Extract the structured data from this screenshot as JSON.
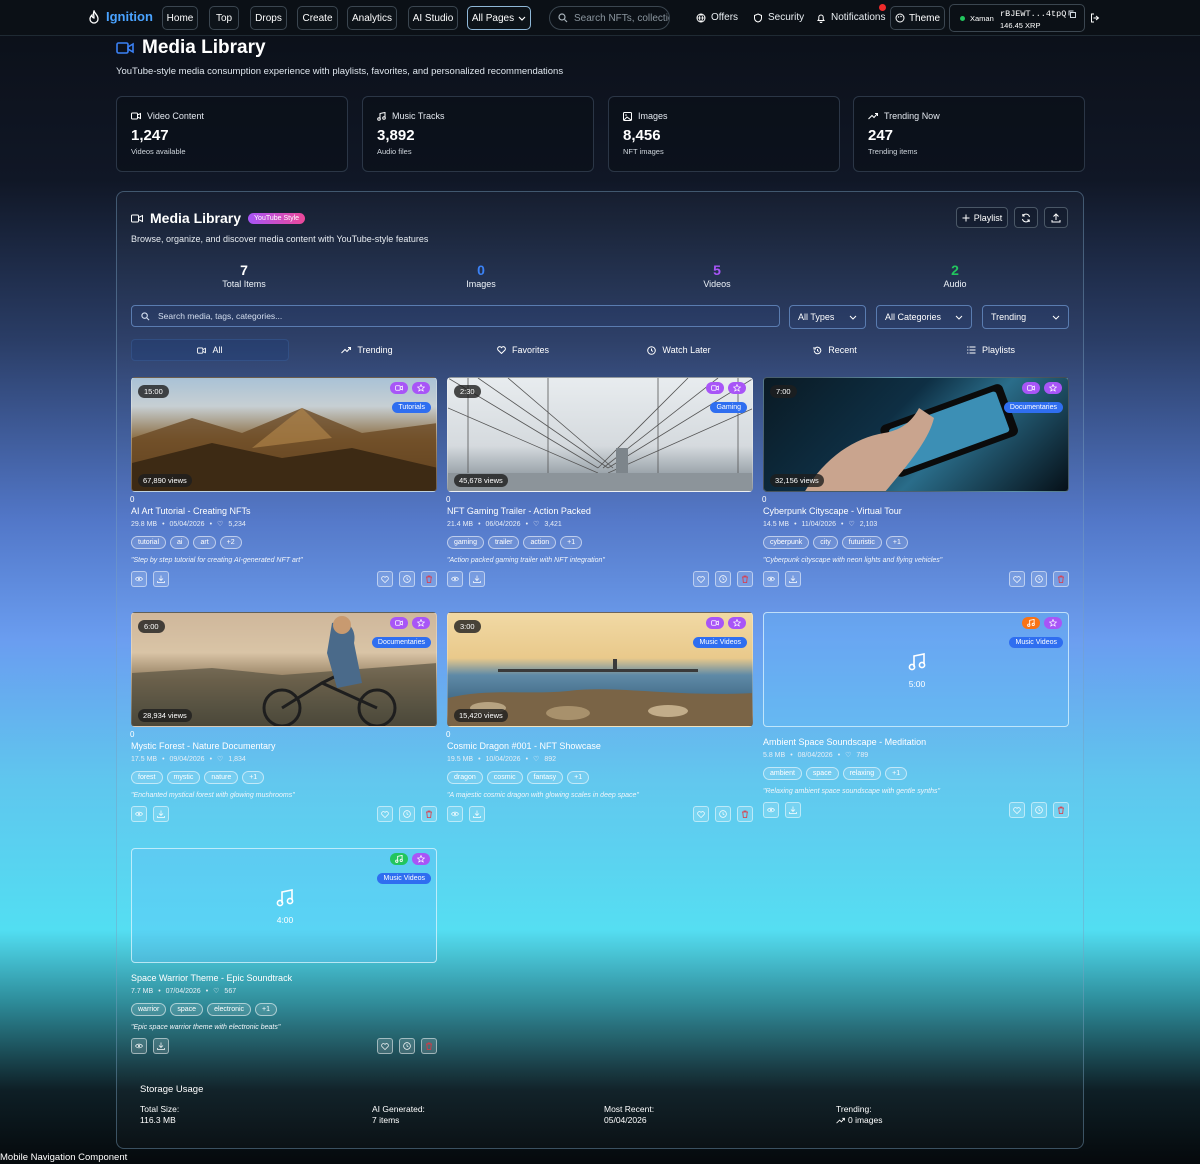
{
  "nav": {
    "brand": "Ignition",
    "items": [
      "Home",
      "Top",
      "Drops",
      "Create",
      "Analytics",
      "AI Studio"
    ],
    "all_pages": "All Pages",
    "search_placeholder": "Search NFTs, collections...",
    "offers": "Offers",
    "security": "Security",
    "notifications": "Notifications",
    "theme": "Theme",
    "wallet_name": "Xaman",
    "wallet_addr": "rBJEWT...4tpQ",
    "wallet_balance": "146.45 XRP"
  },
  "header": {
    "title": "Media Library",
    "subtitle": "YouTube-style media consumption experience with playlists, favorites, and personalized recommendations"
  },
  "stats": [
    {
      "label": "Video Content",
      "value": "1,247",
      "sub": "Videos available"
    },
    {
      "label": "Music Tracks",
      "value": "3,892",
      "sub": "Audio files"
    },
    {
      "label": "Images",
      "value": "8,456",
      "sub": "NFT images"
    },
    {
      "label": "Trending Now",
      "value": "247",
      "sub": "Trending items"
    }
  ],
  "library": {
    "title": "Media Library",
    "badge": "YouTube Style",
    "subtitle": "Browse, organize, and discover media content with YouTube-style features",
    "playlist_btn": "Playlist",
    "counts": [
      {
        "n": "7",
        "l": "Total Items",
        "color": "#ffffff"
      },
      {
        "n": "0",
        "l": "Images",
        "color": "#3b82f6"
      },
      {
        "n": "5",
        "l": "Videos",
        "color": "#a855f7"
      },
      {
        "n": "2",
        "l": "Audio",
        "color": "#22c55e"
      }
    ],
    "search_placeholder": "Search media, tags, categories...",
    "filters": [
      "All Types",
      "All Categories",
      "Trending"
    ],
    "tabs": [
      "All",
      "Trending",
      "Favorites",
      "Watch Later",
      "Recent",
      "Playlists"
    ]
  },
  "cards": [
    {
      "duration": "15:00",
      "views": "67,890 views",
      "category": "Tutorials",
      "zero": "0",
      "title": "AI Art Tutorial - Creating NFTs",
      "size": "29.8 MB",
      "date": "05/04/2026",
      "likes": "5,234",
      "tags": [
        "tutorial",
        "ai",
        "art",
        "+2"
      ],
      "desc": "\"Step by step tutorial for creating AI-generated NFT art\""
    },
    {
      "duration": "2:30",
      "views": "45,678 views",
      "category": "Gaming",
      "zero": "0",
      "title": "NFT Gaming Trailer - Action Packed",
      "size": "21.4 MB",
      "date": "06/04/2026",
      "likes": "3,421",
      "tags": [
        "gaming",
        "trailer",
        "action",
        "+1"
      ],
      "desc": "\"Action packed gaming trailer with NFT integration\""
    },
    {
      "duration": "7:00",
      "views": "32,156 views",
      "category": "Documentaries",
      "zero": "0",
      "title": "Cyberpunk Cityscape - Virtual Tour",
      "size": "14.5 MB",
      "date": "11/04/2026",
      "likes": "2,103",
      "tags": [
        "cyberpunk",
        "city",
        "futuristic",
        "+1"
      ],
      "desc": "\"Cyberpunk cityscape with neon lights and flying vehicles\""
    },
    {
      "duration": "6:00",
      "views": "28,934 views",
      "category": "Documentaries",
      "zero": "0",
      "title": "Mystic Forest - Nature Documentary",
      "size": "17.5 MB",
      "date": "09/04/2026",
      "likes": "1,834",
      "tags": [
        "forest",
        "mystic",
        "nature",
        "+1"
      ],
      "desc": "\"Enchanted mystical forest with glowing mushrooms\""
    },
    {
      "duration": "3:00",
      "views": "15,420 views",
      "category": "Music Videos",
      "zero": "0",
      "title": "Cosmic Dragon #001 - NFT Showcase",
      "size": "19.5 MB",
      "date": "10/04/2026",
      "likes": "892",
      "tags": [
        "dragon",
        "cosmic",
        "fantasy",
        "+1"
      ],
      "desc": "\"A majestic cosmic dragon with glowing scales in deep space\""
    },
    {
      "duration": "5:00",
      "category": "Music Videos",
      "title": "Ambient Space Soundscape - Meditation",
      "size": "5.8 MB",
      "date": "08/04/2026",
      "likes": "789",
      "tags": [
        "ambient",
        "space",
        "relaxing",
        "+1"
      ],
      "desc": "\"Relaxing ambient space soundscape with gentle synths\""
    },
    {
      "duration": "4:00",
      "category": "Music Videos",
      "title": "Space Warrior Theme - Epic Soundtrack",
      "size": "7.7 MB",
      "date": "07/04/2026",
      "likes": "567",
      "tags": [
        "warrior",
        "space",
        "electronic",
        "+1"
      ],
      "desc": "\"Epic space warrior theme with electronic beats\""
    }
  ],
  "storage": {
    "title": "Storage Usage",
    "cols": [
      {
        "l": "Total Size:",
        "v": "116.3 MB"
      },
      {
        "l": "AI Generated:",
        "v": "7 items"
      },
      {
        "l": "Most Recent:",
        "v": "05/04/2026"
      },
      {
        "l": "Trending:",
        "v": "0 images"
      }
    ]
  },
  "footer": {
    "mobile": "Mobile Navigation Component"
  },
  "colors": {
    "accent": "#4aa3ff",
    "purple": "#a855f7",
    "category": "#2f6ef0"
  }
}
